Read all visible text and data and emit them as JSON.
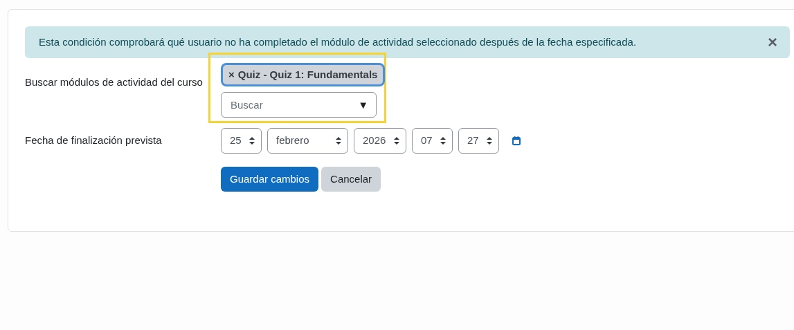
{
  "alert": {
    "text": "Esta condición comprobará qué usuario no ha completado el módulo de actividad seleccionado después de la fecha especificada.",
    "close": "×"
  },
  "module_search": {
    "label": "Buscar módulos de actividad del curso",
    "highlighted": true,
    "selected_items": [
      {
        "remove": "×",
        "text": "Quiz - Quiz 1: Fundamentals"
      }
    ],
    "search": {
      "placeholder": "Buscar",
      "arrow": "▼"
    }
  },
  "due_date": {
    "label": "Fecha de finalización prevista",
    "selects": [
      {
        "value": "25"
      },
      {
        "value": "febrero"
      },
      {
        "value": "2026"
      },
      {
        "value": "07"
      },
      {
        "value": "27"
      }
    ]
  },
  "buttons": [
    {
      "label": "Guardar cambios",
      "kind": "primary"
    },
    {
      "label": "Cancelar",
      "kind": "secondary"
    }
  ]
}
